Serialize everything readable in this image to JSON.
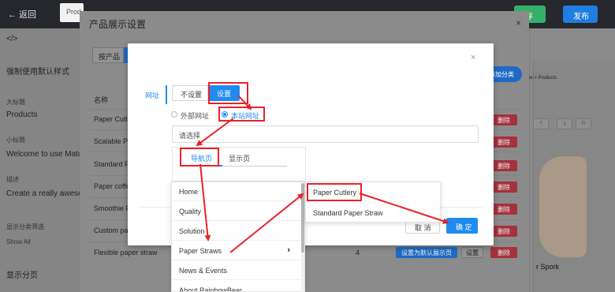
{
  "topbar": {
    "back": "← 返回",
    "tab": "Prod",
    "save": "存",
    "publish": "发布"
  },
  "left_panel": {
    "code_icon": "</>",
    "force_default": "强制使用默认样式",
    "main_title_label": "大标题",
    "main_title_value": "Products",
    "subtitle_label": "小标题",
    "subtitle_value": "Welcome to use Match",
    "desc_label": "描述",
    "desc_value": "Create a really awesom",
    "filter_label": "显示分类筛选",
    "filter_value": "Show All",
    "show_category": "显示分页"
  },
  "outer_modal": {
    "title": "产品展示设置",
    "close": "×",
    "tab": "按产品",
    "add_category": "添加分类",
    "name_header": "名称",
    "rows": [
      "Paper Cutle",
      "Scalable Pap",
      "Standard Pa",
      "Paper coffe",
      "Smoothie Pa",
      "Custom pap",
      "Flexible paper straw"
    ],
    "delete_label": "删除",
    "last_row_num": "4",
    "set_default": "设置为默认展示页",
    "set_label": "设置"
  },
  "preview": {
    "breadcrumb": "ome > Products",
    "caption": "r Spork",
    "toolbar": [
      "↑",
      "↓",
      "☆"
    ]
  },
  "dialog": {
    "close": "×",
    "url_tab": "网址",
    "btn_noset": "不设置",
    "btn_set": "设置",
    "radio_external": "外部网址",
    "radio_local": "本站网址",
    "select_placeholder": "请选择",
    "tab_nav": "导航页",
    "tab_display": "显示页",
    "cancel": "取 消",
    "ok": "确 定"
  },
  "nav_list": [
    "Home",
    "Quality",
    "Solution",
    "Paper Straws",
    "News & Events",
    "About RainbowBear"
  ],
  "sub_list": [
    "Paper Cutlery",
    "Standard Paper Straw"
  ],
  "colors": {
    "accent": "#1f8bf0",
    "annotation": "#e8222a",
    "danger": "#a4323b"
  }
}
